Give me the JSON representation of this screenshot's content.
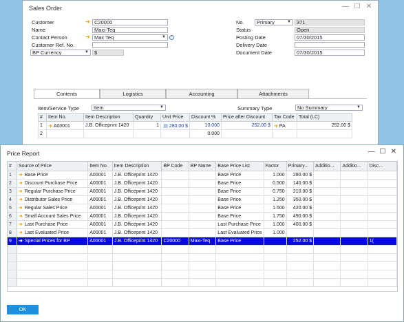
{
  "sales_order": {
    "title": "Sales Order",
    "customer_label": "Customer",
    "customer_value": "C20000",
    "name_label": "Name",
    "name_value": "Maxi-Teq",
    "contact_label": "Contact Person",
    "contact_value": "Max Teq",
    "ref_label": "Customer Ref. No.",
    "ref_value": "",
    "currency_select": "BP Currency",
    "currency_value": "$",
    "no_label": "No.",
    "no_series": "Primary",
    "no_value": "371",
    "status_label": "Status",
    "status_value": "Open",
    "posting_label": "Posting Date",
    "posting_value": "07/30/2015",
    "delivery_label": "Delivery Date",
    "delivery_value": "",
    "document_label": "Document Date",
    "document_value": "07/30/2015",
    "tabs": [
      "Contents",
      "Logistics",
      "Accounting",
      "Attachments"
    ],
    "item_service_label": "Item/Service Type",
    "item_service_value": "Item",
    "summary_label": "Summary Type",
    "summary_value": "No Summary",
    "grid_headers": [
      "#",
      "Item No.",
      "Item Description",
      "Quantity",
      "Unit Price",
      "Discount %",
      "Price after Discount",
      "Tax Code",
      "Total (LC)"
    ],
    "grid_rows": [
      [
        "1",
        "A00001",
        "J.B. Officeprint 1420",
        "1",
        "280.00 $",
        "10.000",
        "252.00 $",
        "PA",
        "252.00 $"
      ],
      [
        "2",
        "",
        "",
        "",
        "",
        "0.000",
        "",
        "",
        ""
      ]
    ]
  },
  "price_report": {
    "title": "Price Report",
    "headers": [
      "#",
      "Source of Price",
      "Item No.",
      "Item Description",
      "BP Code",
      "BP Name",
      "Base Price List",
      "Factor",
      "Primary...",
      "Additio...",
      "Additio...",
      "Disc..."
    ],
    "rows": [
      [
        "1",
        "Base Price",
        "A00001",
        "J.B. Officeprint 1420",
        "",
        "",
        "Base Price",
        "1.000",
        "280.00 $",
        "",
        "",
        ""
      ],
      [
        "2",
        "Discount Purchase Price",
        "A00001",
        "J.B. Officeprint 1420",
        "",
        "",
        "Base Price",
        "0.500",
        "140.00 $",
        "",
        "",
        ""
      ],
      [
        "3",
        "Regular Purchase Price",
        "A00001",
        "J.B. Officeprint 1420",
        "",
        "",
        "Base Price",
        "0.750",
        "210.00 $",
        "",
        "",
        ""
      ],
      [
        "4",
        "Distributor Sales Price",
        "A00001",
        "J.B. Officeprint 1420",
        "",
        "",
        "Base Price",
        "1.250",
        "350.00 $",
        "",
        "",
        ""
      ],
      [
        "5",
        "Regular Sales Price",
        "A00001",
        "J.B. Officeprint 1420",
        "",
        "",
        "Base Price",
        "1.500",
        "420.00 $",
        "",
        "",
        ""
      ],
      [
        "6",
        "Small Account Sales Price",
        "A00001",
        "J.B. Officeprint 1420",
        "",
        "",
        "Base Price",
        "1.750",
        "490.00 $",
        "",
        "",
        ""
      ],
      [
        "7",
        "Last Purchase Price",
        "A00001",
        "J.B. Officeprint 1420",
        "",
        "",
        "Last Purchase Price",
        "1.000",
        "400.00 $",
        "",
        "",
        ""
      ],
      [
        "8",
        "Last Evaluated Price",
        "A00001",
        "J.B. Officeprint 1420",
        "",
        "",
        "Last Evaluated Price",
        "1.000",
        "",
        "",
        "",
        ""
      ],
      [
        "9",
        "Special Prices for BP",
        "A00001",
        "J.B. Officeprint 1420",
        "C20000",
        "Maxi-Teq",
        "Base Price",
        "",
        "252.00 $",
        "",
        "",
        "1("
      ]
    ],
    "selected_row": 9,
    "ok_label": "OK"
  }
}
